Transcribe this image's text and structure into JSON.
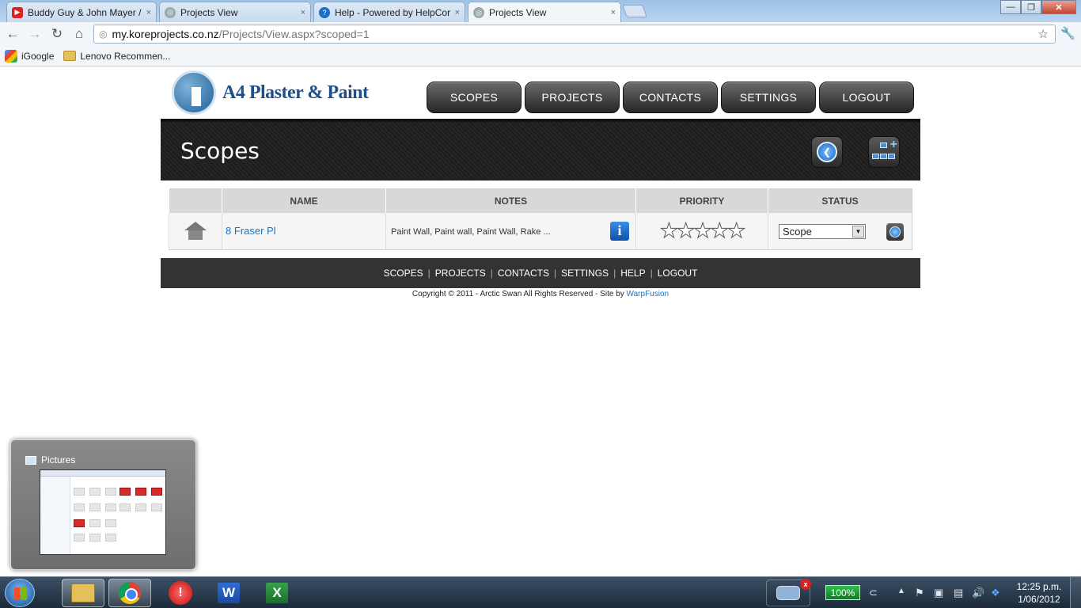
{
  "browser": {
    "tabs": [
      {
        "label": "Buddy Guy & John Mayer /",
        "icon": "youtube-icon",
        "active": false
      },
      {
        "label": "Projects View",
        "icon": "globe-icon",
        "active": false
      },
      {
        "label": "Help - Powered by HelpCor",
        "icon": "help-icon",
        "active": false
      },
      {
        "label": "Projects View",
        "icon": "globe-icon",
        "active": true
      }
    ],
    "tab_close": "×",
    "url_host": "my.koreprojects.co.nz",
    "url_path": "/Projects/View.aspx?scoped=1",
    "bookmarks": [
      {
        "label": "iGoogle",
        "icon": "igoogle-icon"
      },
      {
        "label": "Lenovo Recommen...",
        "icon": "folder-icon"
      }
    ],
    "window_controls": {
      "minimize": "—",
      "maximize": "❐",
      "close": "✕"
    }
  },
  "site": {
    "logo_text": "A4 Plaster & Paint",
    "nav": [
      "SCOPES",
      "PROJECTS",
      "CONTACTS",
      "SETTINGS",
      "LOGOUT"
    ],
    "page_title": "Scopes",
    "table": {
      "headers": {
        "icon": "",
        "name": "NAME",
        "notes": "NOTES",
        "priority": "PRIORITY",
        "status": "STATUS"
      },
      "rows": [
        {
          "name": "8 Fraser Pl",
          "notes": "Paint Wall, Paint wall, Paint Wall, Rake ...",
          "priority_stars_filled": 0,
          "priority_stars_total": 5,
          "status": "Scope"
        }
      ]
    },
    "footer_links": [
      "SCOPES",
      "PROJECTS",
      "CONTACTS",
      "SETTINGS",
      "HELP",
      "LOGOUT"
    ],
    "footer_separator": "|",
    "copyright_text": "Copyright © 2011 - Arctic Swan All Rights Reserved - Site by",
    "copyright_link": "WarpFusion"
  },
  "taskbar": {
    "thumbnail_title": "Pictures",
    "battery": "100%",
    "time": "12:25 p.m.",
    "date": "1/06/2012",
    "network_badge": "x",
    "apps": [
      "windows-explorer",
      "google-chrome",
      "red-app",
      "microsoft-word",
      "microsoft-excel"
    ]
  }
}
